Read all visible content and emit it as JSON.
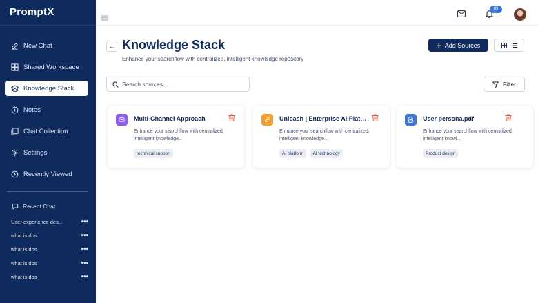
{
  "app": {
    "logo_text": "PromptX"
  },
  "sidebar": {
    "items": [
      {
        "label": "New Chat",
        "icon": "edit-icon"
      },
      {
        "label": "Shared Workspace",
        "icon": "workspace-icon"
      },
      {
        "label": "Knowledge Stack",
        "icon": "layers-icon",
        "active": true
      },
      {
        "label": "Notes",
        "icon": "notes-icon"
      },
      {
        "label": "Chat Collection",
        "icon": "collection-icon"
      },
      {
        "label": "Settings",
        "icon": "gear-icon"
      },
      {
        "label": "Recently Viewed",
        "icon": "clock-icon"
      }
    ],
    "recent_heading": "Recent Chat",
    "recent": [
      {
        "label": "User experience des..."
      },
      {
        "label": "what is dbs"
      },
      {
        "label": "what is dbs"
      },
      {
        "label": "what is dbs"
      },
      {
        "label": "what is dbs"
      }
    ],
    "more_glyph": "•••"
  },
  "topbar": {
    "notification_count": "03"
  },
  "header": {
    "back_glyph": "←",
    "title": "Knowledge Stack",
    "subtitle": "Enhance your searchflow with centralized, intelligent knowledge repository",
    "add_label": "Add Sources",
    "add_glyph": "+"
  },
  "search": {
    "placeholder": "Search sources..."
  },
  "filter": {
    "label": "Filter"
  },
  "cards": [
    {
      "title": "Multi-Channel Approach",
      "description": "Enhance your searchflow with centralized, intelligent knowledge...",
      "tags": [
        "technical support"
      ],
      "icon": "channel-icon",
      "icon_color": "#8b5cf6"
    },
    {
      "title": "Unleash | Enterprise AI Platform",
      "description": "Enhance your searchflow with centralized, intelligent knowledge...",
      "tags": [
        "AI platform",
        "AI technology"
      ],
      "icon": "link-icon",
      "icon_color": "#f59e2c"
    },
    {
      "title": "User persona.pdf",
      "description": "Enhance your searchflow with centralized, intelligent knowl...",
      "tags": [
        "Product design"
      ],
      "icon": "document-icon",
      "icon_color": "#3b78d8"
    }
  ],
  "colors": {
    "sidebar_bg": "#0f2a5c",
    "accent": "#0f2a5c",
    "delete": "#e5533d"
  }
}
